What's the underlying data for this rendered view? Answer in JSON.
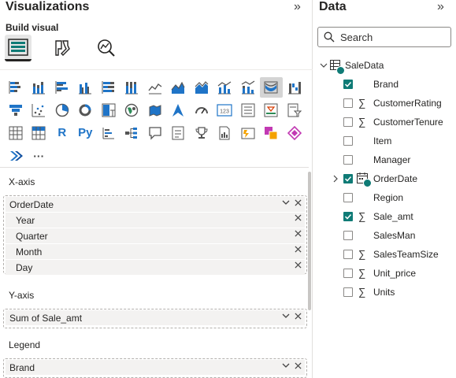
{
  "visualizations": {
    "title": "Visualizations",
    "collapse_glyph": "»",
    "build_visual_label": "Build visual",
    "build_icons": [
      "build-visual-icon",
      "format-visual-icon",
      "analytics-icon"
    ],
    "gallery": {
      "selected_icon": "ribbon-chart-icon",
      "row1": [
        "stacked-bar-chart-icon",
        "stacked-column-chart-icon",
        "clustered-bar-chart-icon",
        "clustered-column-chart-icon",
        "100-stacked-bar-chart-icon",
        "100-stacked-column-chart-icon",
        "line-chart-icon",
        "area-chart-icon",
        "stacked-area-chart-icon",
        "line-clustered-column-chart-icon",
        "line-stacked-column-chart-icon",
        "ribbon-chart-icon",
        "waterfall-chart-icon"
      ],
      "row2": [
        "funnel-chart-icon",
        "scatter-chart-icon",
        "pie-chart-icon",
        "donut-chart-icon",
        "treemap-icon",
        "map-icon",
        "filled-map-icon",
        "azure-map-icon",
        "gauge-icon",
        "card-icon",
        "multi-row-card-icon",
        "kpi-icon",
        "slicer-icon"
      ],
      "row3_labels": {
        "r": "R",
        "py": "Py",
        "more": "···"
      }
    },
    "x_axis": {
      "label": "X-axis",
      "field": "OrderDate",
      "children": [
        "Year",
        "Quarter",
        "Month",
        "Day"
      ]
    },
    "y_axis": {
      "label": "Y-axis",
      "field": "Sum of Sale_amt"
    },
    "legend": {
      "label": "Legend",
      "field": "Brand"
    }
  },
  "data_pane": {
    "title": "Data",
    "collapse_glyph": "»",
    "search_placeholder": "Search",
    "table": "SaleData",
    "fields": [
      {
        "name": "Brand",
        "checked": true,
        "sigma": false
      },
      {
        "name": "CustomerRating",
        "checked": false,
        "sigma": true
      },
      {
        "name": "CustomerTenure",
        "checked": false,
        "sigma": true
      },
      {
        "name": "Item",
        "checked": false,
        "sigma": false
      },
      {
        "name": "Manager",
        "checked": false,
        "sigma": false
      },
      {
        "name": "OrderDate",
        "checked": true,
        "sigma": false,
        "hierarchy": true
      },
      {
        "name": "Region",
        "checked": false,
        "sigma": false
      },
      {
        "name": "Sale_amt",
        "checked": true,
        "sigma": true
      },
      {
        "name": "SalesMan",
        "checked": false,
        "sigma": false
      },
      {
        "name": "SalesTeamSize",
        "checked": false,
        "sigma": true
      },
      {
        "name": "Unit_price",
        "checked": false,
        "sigma": true
      },
      {
        "name": "Units",
        "checked": false,
        "sigma": true
      }
    ]
  },
  "colors": {
    "accent": "#0f7b76",
    "blue": "#1f74c7",
    "dark": "#252423"
  }
}
